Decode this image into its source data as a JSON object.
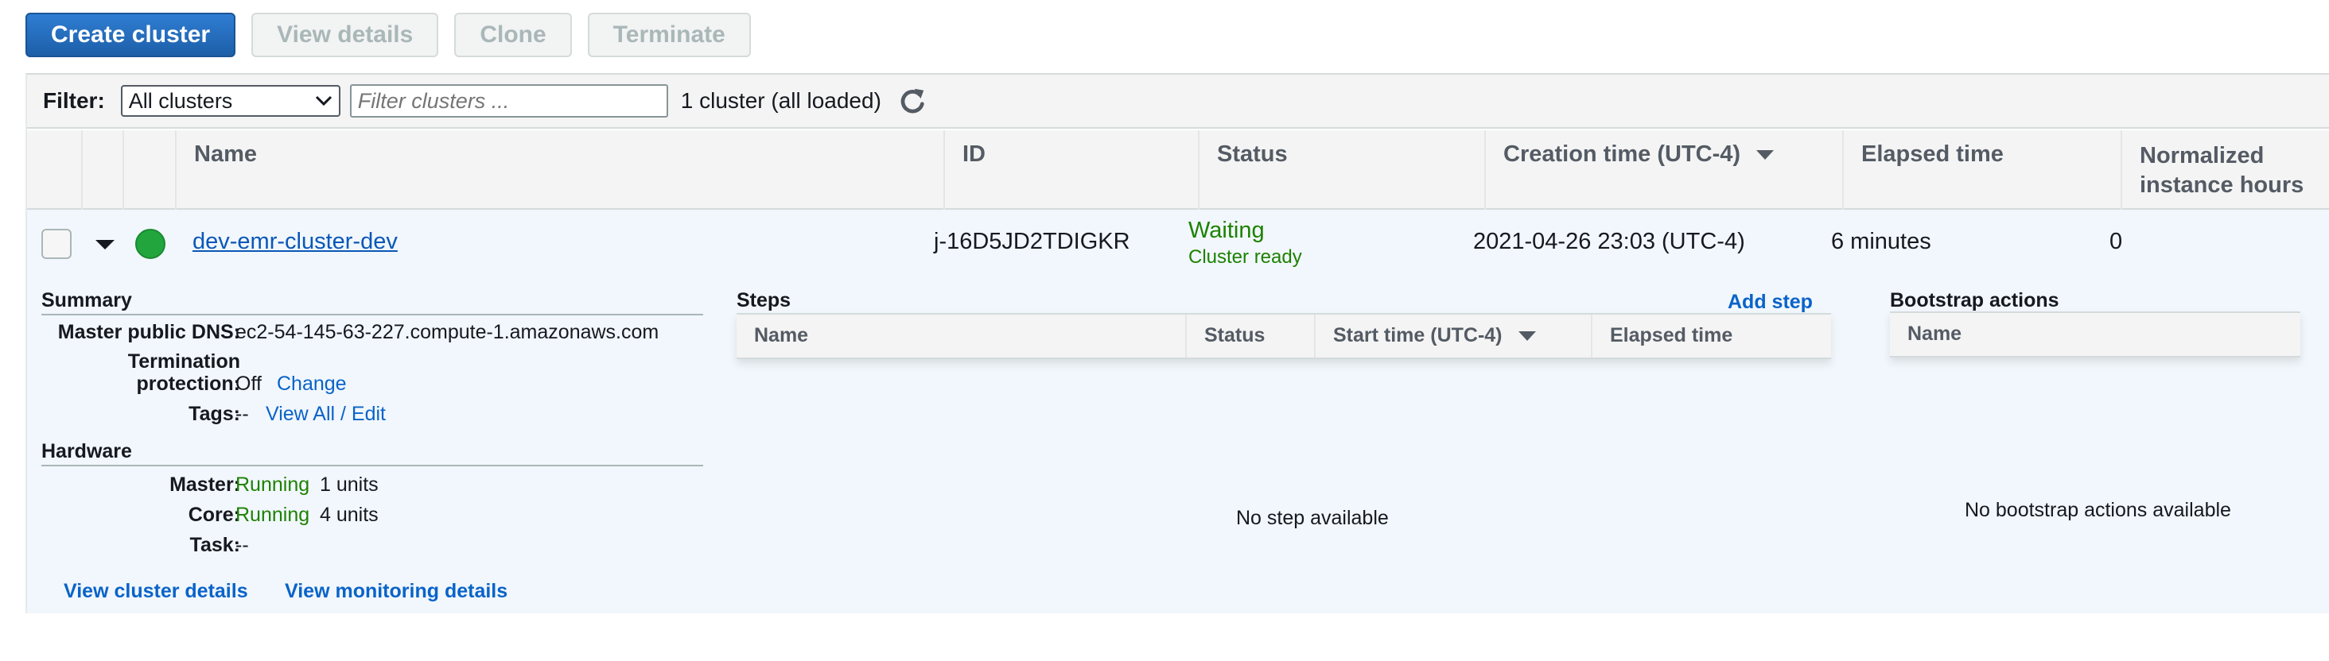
{
  "toolbar": {
    "create": "Create cluster",
    "view_details": "View details",
    "clone": "Clone",
    "terminate": "Terminate"
  },
  "filter": {
    "label": "Filter:",
    "select_value": "All clusters",
    "input_placeholder": "Filter clusters ...",
    "count_text": "1 cluster (all loaded)"
  },
  "table": {
    "headers": {
      "name": "Name",
      "id": "ID",
      "status": "Status",
      "creation_time": "Creation time (UTC-4)",
      "elapsed_time": "Elapsed time",
      "normalized_line1": "Normalized",
      "normalized_line2": "instance hours"
    },
    "row": {
      "name": "dev-emr-cluster-dev",
      "id": "j-16D5JD2TDIGKR",
      "status": "Waiting",
      "status_detail": "Cluster ready",
      "creation_time": "2021-04-26 23:03 (UTC-4)",
      "elapsed_time": "6 minutes",
      "normalized_hours": "0",
      "status_color": "#1d8102"
    }
  },
  "detail": {
    "summary": {
      "title": "Summary",
      "dns_label": "Master public DNS:",
      "dns_value": "ec2-54-145-63-227.compute-1.amazonaws.com",
      "termination_label_line1": "Termination",
      "termination_label_line2": "protection:",
      "termination_value": "Off",
      "termination_change": "Change",
      "tags_label": "Tags:",
      "tags_value": "--",
      "tags_link": "View All / Edit"
    },
    "hardware": {
      "title": "Hardware",
      "master_label": "Master:",
      "master_status": "Running",
      "master_units": "1 units",
      "core_label": "Core:",
      "core_status": "Running",
      "core_units": "4 units",
      "task_label": "Task:",
      "task_value": "--"
    },
    "links": {
      "cluster_details": "View cluster details",
      "monitoring_details": "View monitoring details"
    },
    "steps": {
      "title": "Steps",
      "add_step": "Add step",
      "headers": {
        "name": "Name",
        "status": "Status",
        "start_time": "Start time (UTC-4)",
        "elapsed_time": "Elapsed time"
      },
      "empty": "No step available"
    },
    "bootstrap": {
      "title": "Bootstrap actions",
      "header_name": "Name",
      "empty": "No bootstrap actions available"
    }
  },
  "colors": {
    "primary_button": "#1d5fa8",
    "link": "#0a63c9",
    "running": "#1d8102",
    "row_highlight": "#f1f7fc"
  }
}
